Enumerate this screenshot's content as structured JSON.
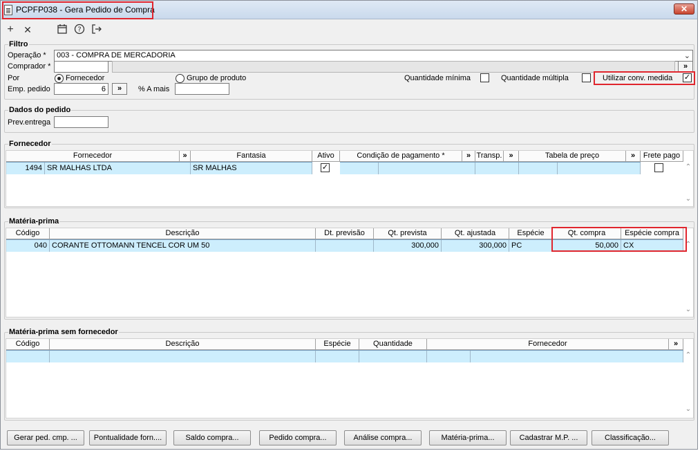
{
  "window": {
    "title": "PCPFP038 - Gera Pedido de Compra",
    "close_glyph": "✕"
  },
  "toolbar": {
    "add": "+",
    "remove": "✕",
    "calendar": "calendar-icon",
    "help": "?",
    "exit": "exit-icon"
  },
  "filtro": {
    "title": "Filtro",
    "operacao_label": "Operação *",
    "operacao_value": "003 - COMPRA DE MERCADORIA",
    "comprador_label": "Comprador *",
    "comprador_value": "",
    "por_label": "Por",
    "radio_fornecedor": "Fornecedor",
    "radio_grupo": "Grupo de produto",
    "qtd_minima_label": "Quantidade mínima",
    "qtd_multipla_label": "Quantidade múltipla",
    "conv_medida_label": "Utilizar conv. medida",
    "emp_pedido_label": "Emp. pedido",
    "emp_pedido_value": "6",
    "a_mais_label": "% A mais",
    "a_mais_value": "",
    "lookup": "»"
  },
  "dados": {
    "title": "Dados do pedido",
    "prev_entrega_label": "Prev.entrega",
    "prev_entrega_value": ""
  },
  "fornecedor": {
    "title": "Fornecedor",
    "headers": {
      "fornecedor": "Fornecedor",
      "fantasia": "Fantasia",
      "ativo": "Ativo",
      "condicao": "Condição de pagamento *",
      "transp": "Transp.",
      "tabela": "Tabela de preço",
      "frete": "Frete pago"
    },
    "row": {
      "codigo": "1494",
      "nome": "SR MALHAS LTDA",
      "fantasia": "SR  MALHAS",
      "ativo": "✓"
    }
  },
  "materia": {
    "title": "Matéria-prima",
    "headers": {
      "codigo": "Código",
      "descricao": "Descrição",
      "dt_previsao": "Dt. previsão",
      "qt_prevista": "Qt. prevista",
      "qt_ajustada": "Qt. ajustada",
      "especie": "Espécie",
      "qt_compra": "Qt. compra",
      "especie_compra": "Espécie compra"
    },
    "row": {
      "codigo": "040",
      "descricao": "CORANTE OTTOMANN TENCEL COR UM 50",
      "dt_previsao": "",
      "qt_prevista": "300,000",
      "qt_ajustada": "300,000",
      "especie": "PC",
      "qt_compra": "50,000",
      "especie_compra": "CX"
    }
  },
  "sem_fornecedor": {
    "title": "Matéria-prima sem fornecedor",
    "headers": {
      "codigo": "Código",
      "descricao": "Descrição",
      "especie": "Espécie",
      "quantidade": "Quantidade",
      "fornecedor": "Fornecedor"
    }
  },
  "buttons": [
    "Gerar ped. cmp. ...",
    "Pontualidade forn....",
    "Saldo compra...",
    "Pedido compra...",
    "Análise compra...",
    "Matéria-prima...",
    "Cadastrar M.P. ...",
    "Classificação..."
  ],
  "scroll": {
    "up": "⌃",
    "down": "⌄",
    "dropdown": "⌄"
  }
}
